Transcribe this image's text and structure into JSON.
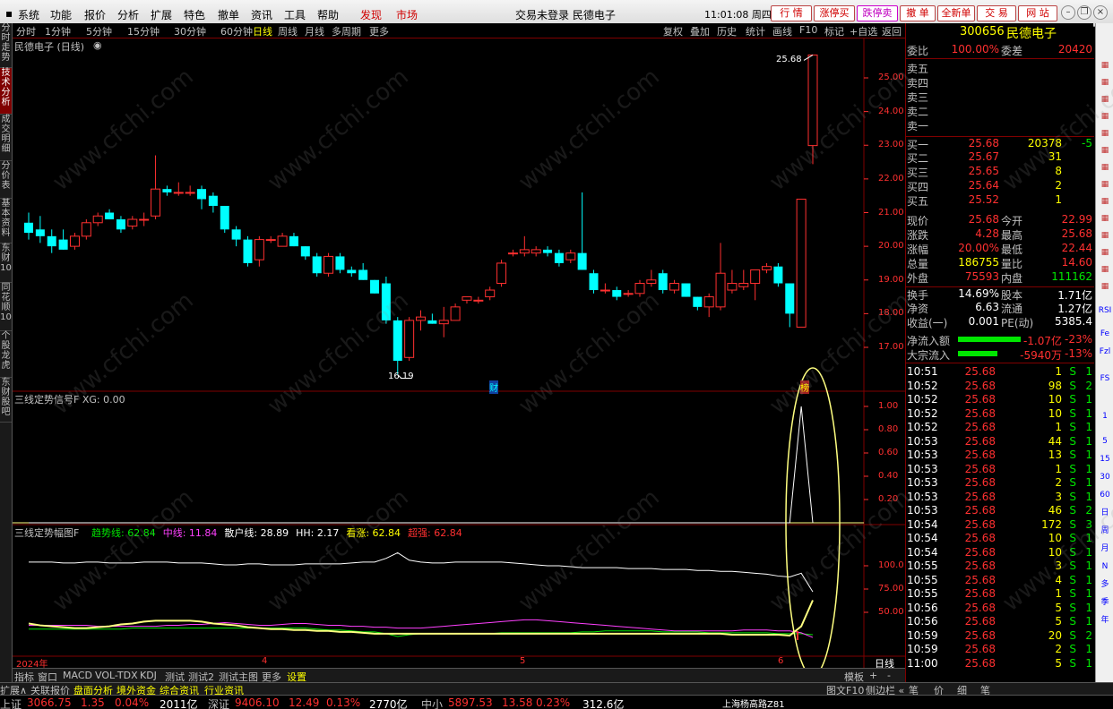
{
  "menu": {
    "items": [
      "系统",
      "功能",
      "报价",
      "分析",
      "扩展",
      "特色",
      "撤单",
      "资讯",
      "工具",
      "帮助"
    ],
    "discover": "发现",
    "market": "市场",
    "center_title": "交易未登录  民德电子",
    "clock": "11:01:08 周四",
    "buttons": [
      "行  情",
      "涨停买",
      "跌停卖",
      "撤  单",
      "全新单",
      "交  易",
      "网  站"
    ]
  },
  "toolbar": {
    "periods": [
      "分时",
      "1分钟",
      "5分钟",
      "15分钟",
      "30分钟",
      "60分钟",
      "日线",
      "周线",
      "月线",
      "多周期",
      "更多"
    ],
    "active_period": "日线",
    "right_tools": [
      "复权",
      "叠加",
      "历史",
      "统计",
      "画线",
      "F10",
      "标记",
      "+自选",
      "返回"
    ]
  },
  "left_tabs": [
    "分时走势",
    "技术分析",
    "成交明细",
    "分价表",
    "基本资料",
    "东财10",
    "同花顺10",
    "个股龙虎",
    "东财股吧"
  ],
  "main_chart": {
    "title": "民德电子 (日线)",
    "high_label": "25.68",
    "low_label": "16.19",
    "y_ticks": [
      "25.00",
      "24.00",
      "23.00",
      "22.00",
      "21.00",
      "20.00",
      "19.00",
      "18.00",
      "17.00"
    ],
    "marker_cai": "财",
    "marker_bang": "榜"
  },
  "signal_pane": {
    "title": "三线定势信号F  XG: 0.00",
    "y_ticks": [
      "1.00",
      "0.80",
      "0.60",
      "0.40",
      "0.20"
    ]
  },
  "trend_pane": {
    "title_prefix": "三线定势幅图F",
    "legend": [
      {
        "label": "趋势线: 62.84",
        "color": "#00e600"
      },
      {
        "label": "中线: 11.84",
        "color": "#ff40ff"
      },
      {
        "label": "散户线: 28.89",
        "color": "#ffffff"
      },
      {
        "label": "HH: 2.17",
        "color": "#ffffff"
      },
      {
        "label": "看涨: 62.84",
        "color": "#ffff00"
      },
      {
        "label": "超强: 62.84",
        "color": "#ff3030"
      }
    ],
    "y_ticks": [
      "100.0",
      "75.00",
      "50.00"
    ]
  },
  "x_axis": {
    "labels": [
      "2024年",
      "4",
      "5",
      "6"
    ],
    "period": "日线"
  },
  "quote": {
    "code": "300656",
    "name": "民德电子",
    "weibi_label": "委比",
    "weibi": "100.00%",
    "weicha_label": "委差",
    "weicha": "20420",
    "sells": [
      {
        "label": "卖五",
        "price": "",
        "vol": ""
      },
      {
        "label": "卖四",
        "price": "",
        "vol": ""
      },
      {
        "label": "卖三",
        "price": "",
        "vol": ""
      },
      {
        "label": "卖二",
        "price": "",
        "vol": ""
      },
      {
        "label": "卖一",
        "price": "",
        "vol": ""
      }
    ],
    "buys": [
      {
        "label": "买一",
        "price": "25.68",
        "vol": "20378",
        "chg": "-5"
      },
      {
        "label": "买二",
        "price": "25.67",
        "vol": "31",
        "chg": ""
      },
      {
        "label": "买三",
        "price": "25.65",
        "vol": "8",
        "chg": ""
      },
      {
        "label": "买四",
        "price": "25.64",
        "vol": "2",
        "chg": ""
      },
      {
        "label": "买五",
        "price": "25.52",
        "vol": "1",
        "chg": ""
      }
    ],
    "stats": [
      {
        "l1": "现价",
        "v1": "25.68",
        "c1": "red",
        "l2": "今开",
        "v2": "22.99",
        "c2": "red"
      },
      {
        "l1": "涨跌",
        "v1": "4.28",
        "c1": "red",
        "l2": "最高",
        "v2": "25.68",
        "c2": "red"
      },
      {
        "l1": "涨幅",
        "v1": "20.00%",
        "c1": "red",
        "l2": "最低",
        "v2": "22.44",
        "c2": "red"
      },
      {
        "l1": "总量",
        "v1": "186755",
        "c1": "yel",
        "l2": "量比",
        "v2": "14.60",
        "c2": "red"
      },
      {
        "l1": "外盘",
        "v1": "75593",
        "c1": "red",
        "l2": "内盘",
        "v2": "111162",
        "c2": "grn"
      },
      {
        "l1": "换手",
        "v1": "14.69%",
        "c1": "wht",
        "l2": "股本",
        "v2": "1.71亿",
        "c2": "wht"
      },
      {
        "l1": "净资",
        "v1": "6.63",
        "c1": "wht",
        "l2": "流通",
        "v2": "1.27亿",
        "c2": "wht"
      },
      {
        "l1": "收益(一)",
        "v1": "0.001",
        "c1": "wht",
        "l2": "PE(动)",
        "v2": "5385.4",
        "c2": "wht"
      }
    ],
    "netflow_label": "净流入额",
    "netflow": "-1.07亿",
    "netflow_pct": "-23%",
    "bigflow_label": "大宗流入",
    "bigflow": "-5940万",
    "bigflow_pct": "-13%"
  },
  "ticks": [
    {
      "t": "10:51",
      "p": "25.68",
      "v": "1",
      "d": "S",
      "n": "1"
    },
    {
      "t": "10:52",
      "p": "25.68",
      "v": "98",
      "d": "S",
      "n": "2"
    },
    {
      "t": "10:52",
      "p": "25.68",
      "v": "10",
      "d": "S",
      "n": "1"
    },
    {
      "t": "10:52",
      "p": "25.68",
      "v": "10",
      "d": "S",
      "n": "1"
    },
    {
      "t": "10:52",
      "p": "25.68",
      "v": "1",
      "d": "S",
      "n": "1"
    },
    {
      "t": "10:53",
      "p": "25.68",
      "v": "44",
      "d": "S",
      "n": "1"
    },
    {
      "t": "10:53",
      "p": "25.68",
      "v": "13",
      "d": "S",
      "n": "1"
    },
    {
      "t": "10:53",
      "p": "25.68",
      "v": "1",
      "d": "S",
      "n": "1"
    },
    {
      "t": "10:53",
      "p": "25.68",
      "v": "2",
      "d": "S",
      "n": "1"
    },
    {
      "t": "10:53",
      "p": "25.68",
      "v": "3",
      "d": "S",
      "n": "1"
    },
    {
      "t": "10:53",
      "p": "25.68",
      "v": "46",
      "d": "S",
      "n": "2"
    },
    {
      "t": "10:54",
      "p": "25.68",
      "v": "172",
      "d": "S",
      "n": "3"
    },
    {
      "t": "10:54",
      "p": "25.68",
      "v": "10",
      "d": "S",
      "n": "1"
    },
    {
      "t": "10:54",
      "p": "25.68",
      "v": "10",
      "d": "S",
      "n": "1"
    },
    {
      "t": "10:55",
      "p": "25.68",
      "v": "3",
      "d": "S",
      "n": "1"
    },
    {
      "t": "10:55",
      "p": "25.68",
      "v": "4",
      "d": "S",
      "n": "1"
    },
    {
      "t": "10:55",
      "p": "25.68",
      "v": "1",
      "d": "S",
      "n": "1"
    },
    {
      "t": "10:56",
      "p": "25.68",
      "v": "5",
      "d": "S",
      "n": "1"
    },
    {
      "t": "10:56",
      "p": "25.68",
      "v": "5",
      "d": "S",
      "n": "1"
    },
    {
      "t": "10:59",
      "p": "25.68",
      "v": "20",
      "d": "S",
      "n": "2"
    },
    {
      "t": "10:59",
      "p": "25.68",
      "v": "2",
      "d": "S",
      "n": "1"
    },
    {
      "t": "11:00",
      "p": "25.68",
      "v": "5",
      "d": "S",
      "n": "1"
    }
  ],
  "icon_col": [
    "RSI",
    "Fe",
    "Fzl",
    "FS",
    "1",
    "5",
    "15",
    "30",
    "60",
    "日",
    "周",
    "月",
    "N",
    "多",
    "季",
    "年"
  ],
  "bottom_tabs": [
    "指标",
    "窗口",
    "MACD",
    "VOL-TDX",
    "KDJ",
    "测试",
    "测试2",
    "测试主图",
    "更多",
    "设置"
  ],
  "bottom_right": [
    "模板",
    "+",
    "-"
  ],
  "bottom_tabs2": [
    "扩展∧",
    "关联报价",
    "盘面分析",
    "境外资金",
    "综合资讯",
    "行业资讯"
  ],
  "bottom_tabs2_right": [
    "图文F10",
    "侧边栏 «"
  ],
  "bottom_tabs2_far": [
    "笔",
    "价",
    "细",
    "笔"
  ],
  "status": [
    {
      "txt": "上证",
      "c": "gray"
    },
    {
      "txt": "3066.75",
      "c": "red"
    },
    {
      "txt": "1.35",
      "c": "red"
    },
    {
      "txt": "0.04%",
      "c": "red"
    },
    {
      "txt": "2011亿",
      "c": "wht"
    },
    {
      "txt": "深证",
      "c": "gray"
    },
    {
      "txt": "9406.10",
      "c": "red"
    },
    {
      "txt": "12.49",
      "c": "red"
    },
    {
      "txt": "0.13%",
      "c": "red"
    },
    {
      "txt": "2770亿",
      "c": "wht"
    },
    {
      "txt": "中小",
      "c": "gray"
    },
    {
      "txt": "5897.53",
      "c": "red"
    },
    {
      "txt": "13.58",
      "c": "red"
    },
    {
      "txt": "0.23%",
      "c": "red"
    },
    {
      "txt": "312.6亿",
      "c": "wht"
    },
    {
      "txt": "上海杨高路Z81",
      "c": "wht"
    }
  ],
  "watermark": "www.cfchi.com",
  "colors": {
    "up": "#ff3030",
    "down": "#00ffff",
    "accent": "#800000",
    "highlight": "#ffff80"
  },
  "chart_data": {
    "type": "candlestick",
    "ylim": [
      16.19,
      25.68
    ],
    "candles": [
      {
        "o": 20.7,
        "h": 21.0,
        "l": 20.2,
        "c": 20.4
      },
      {
        "o": 20.5,
        "h": 20.9,
        "l": 20.1,
        "c": 20.3
      },
      {
        "o": 20.3,
        "h": 20.5,
        "l": 19.8,
        "c": 20.0
      },
      {
        "o": 20.2,
        "h": 20.5,
        "l": 19.9,
        "c": 19.9
      },
      {
        "o": 20.0,
        "h": 20.4,
        "l": 19.9,
        "c": 20.3
      },
      {
        "o": 20.3,
        "h": 20.8,
        "l": 20.2,
        "c": 20.7
      },
      {
        "o": 20.7,
        "h": 21.0,
        "l": 20.6,
        "c": 20.9
      },
      {
        "o": 21.0,
        "h": 21.1,
        "l": 20.8,
        "c": 20.8
      },
      {
        "o": 20.8,
        "h": 20.9,
        "l": 20.4,
        "c": 20.5
      },
      {
        "o": 20.6,
        "h": 20.9,
        "l": 20.5,
        "c": 20.8
      },
      {
        "o": 20.8,
        "h": 21.0,
        "l": 20.6,
        "c": 20.8
      },
      {
        "o": 20.9,
        "h": 22.7,
        "l": 20.8,
        "c": 21.7
      },
      {
        "o": 21.7,
        "h": 21.8,
        "l": 21.5,
        "c": 21.6
      },
      {
        "o": 21.6,
        "h": 21.9,
        "l": 21.5,
        "c": 21.6
      },
      {
        "o": 21.6,
        "h": 21.8,
        "l": 21.5,
        "c": 21.6
      },
      {
        "o": 21.7,
        "h": 21.8,
        "l": 21.1,
        "c": 21.4
      },
      {
        "o": 21.5,
        "h": 21.6,
        "l": 21.0,
        "c": 21.2
      },
      {
        "o": 21.2,
        "h": 21.2,
        "l": 20.4,
        "c": 20.5
      },
      {
        "o": 20.5,
        "h": 20.6,
        "l": 20.0,
        "c": 20.2
      },
      {
        "o": 20.2,
        "h": 20.3,
        "l": 19.4,
        "c": 19.5
      },
      {
        "o": 19.6,
        "h": 20.3,
        "l": 19.4,
        "c": 20.2
      },
      {
        "o": 20.2,
        "h": 20.3,
        "l": 20.1,
        "c": 20.2
      },
      {
        "o": 20.0,
        "h": 20.4,
        "l": 20.0,
        "c": 20.3
      },
      {
        "o": 20.3,
        "h": 20.4,
        "l": 20.0,
        "c": 20.0
      },
      {
        "o": 20.0,
        "h": 20.0,
        "l": 19.6,
        "c": 19.7
      },
      {
        "o": 19.7,
        "h": 19.8,
        "l": 19.1,
        "c": 19.2
      },
      {
        "o": 19.2,
        "h": 19.8,
        "l": 19.1,
        "c": 19.7
      },
      {
        "o": 19.7,
        "h": 19.8,
        "l": 19.2,
        "c": 19.3
      },
      {
        "o": 19.3,
        "h": 19.4,
        "l": 19.1,
        "c": 19.2
      },
      {
        "o": 19.3,
        "h": 19.5,
        "l": 19.0,
        "c": 19.0
      },
      {
        "o": 19.0,
        "h": 19.0,
        "l": 18.6,
        "c": 18.6
      },
      {
        "o": 18.9,
        "h": 19.1,
        "l": 17.7,
        "c": 17.8
      },
      {
        "o": 17.8,
        "h": 17.9,
        "l": 16.2,
        "c": 16.6
      },
      {
        "o": 16.7,
        "h": 17.9,
        "l": 16.6,
        "c": 17.8
      },
      {
        "o": 17.8,
        "h": 18.1,
        "l": 17.5,
        "c": 17.9
      },
      {
        "o": 17.8,
        "h": 18.0,
        "l": 17.7,
        "c": 17.7
      },
      {
        "o": 17.7,
        "h": 18.2,
        "l": 17.3,
        "c": 17.8
      },
      {
        "o": 17.8,
        "h": 18.3,
        "l": 17.8,
        "c": 18.2
      },
      {
        "o": 18.4,
        "h": 18.5,
        "l": 18.3,
        "c": 18.5
      },
      {
        "o": 18.4,
        "h": 18.5,
        "l": 18.3,
        "c": 18.4
      },
      {
        "o": 18.5,
        "h": 18.8,
        "l": 18.4,
        "c": 18.7
      },
      {
        "o": 18.9,
        "h": 19.6,
        "l": 18.8,
        "c": 19.5
      },
      {
        "o": 19.8,
        "h": 19.9,
        "l": 19.7,
        "c": 19.8
      },
      {
        "o": 19.8,
        "h": 20.3,
        "l": 19.7,
        "c": 19.9
      },
      {
        "o": 19.8,
        "h": 20.0,
        "l": 19.7,
        "c": 19.9
      },
      {
        "o": 19.9,
        "h": 20.0,
        "l": 19.7,
        "c": 19.8
      },
      {
        "o": 19.8,
        "h": 19.9,
        "l": 19.4,
        "c": 19.5
      },
      {
        "o": 19.6,
        "h": 19.9,
        "l": 19.5,
        "c": 19.8
      },
      {
        "o": 19.8,
        "h": 21.6,
        "l": 19.3,
        "c": 19.3
      },
      {
        "o": 19.2,
        "h": 19.3,
        "l": 18.6,
        "c": 18.7
      },
      {
        "o": 18.7,
        "h": 18.9,
        "l": 18.6,
        "c": 18.7
      },
      {
        "o": 18.7,
        "h": 18.8,
        "l": 18.4,
        "c": 18.5
      },
      {
        "o": 18.6,
        "h": 18.7,
        "l": 18.5,
        "c": 18.6
      },
      {
        "o": 18.6,
        "h": 19.0,
        "l": 18.5,
        "c": 18.9
      },
      {
        "o": 18.9,
        "h": 19.3,
        "l": 18.8,
        "c": 19.0
      },
      {
        "o": 19.2,
        "h": 19.3,
        "l": 18.6,
        "c": 18.7
      },
      {
        "o": 18.7,
        "h": 19.0,
        "l": 18.6,
        "c": 18.9
      },
      {
        "o": 18.9,
        "h": 18.9,
        "l": 18.5,
        "c": 18.5
      },
      {
        "o": 18.5,
        "h": 18.5,
        "l": 18.1,
        "c": 18.2
      },
      {
        "o": 18.2,
        "h": 18.6,
        "l": 17.9,
        "c": 18.5
      },
      {
        "o": 18.2,
        "h": 20.1,
        "l": 18.1,
        "c": 19.2
      },
      {
        "o": 18.7,
        "h": 19.3,
        "l": 18.6,
        "c": 18.9
      },
      {
        "o": 18.8,
        "h": 19.3,
        "l": 18.7,
        "c": 18.9
      },
      {
        "o": 18.9,
        "h": 19.3,
        "l": 18.4,
        "c": 19.3
      },
      {
        "o": 19.3,
        "h": 19.5,
        "l": 19.2,
        "c": 19.4
      },
      {
        "o": 19.4,
        "h": 19.5,
        "l": 18.8,
        "c": 18.9
      },
      {
        "o": 18.9,
        "h": 18.9,
        "l": 17.6,
        "c": 18.0
      },
      {
        "o": 17.6,
        "h": 21.4,
        "l": 17.6,
        "c": 21.4
      },
      {
        "o": 22.99,
        "h": 25.68,
        "l": 22.44,
        "c": 25.68
      }
    ],
    "signal_series": [
      0,
      0,
      0,
      0,
      0,
      0,
      0,
      0,
      0,
      0,
      0,
      0,
      0,
      0,
      0,
      0,
      0,
      0,
      0,
      0,
      0,
      0,
      0,
      0,
      0,
      0,
      0,
      0,
      0,
      0,
      0,
      0,
      0,
      0,
      0,
      0,
      0,
      0,
      0,
      0,
      0,
      0,
      0,
      0,
      0,
      0,
      0,
      0,
      0,
      0,
      0,
      0,
      0,
      0,
      0,
      0,
      0,
      0,
      0,
      0,
      0,
      0,
      0,
      0,
      0,
      0,
      0,
      1.0,
      0.0
    ],
    "trend_white": [
      104,
      104,
      104,
      103,
      103,
      104,
      104,
      103,
      103,
      103,
      104,
      104,
      104,
      103,
      103,
      103,
      102,
      101,
      101,
      102,
      102,
      101,
      101,
      101,
      102,
      102,
      102,
      102,
      103,
      104,
      104,
      108,
      114,
      106,
      104,
      103,
      103,
      104,
      104,
      104,
      104,
      104,
      103,
      102,
      101,
      100,
      100,
      99,
      98,
      98,
      98,
      98,
      97,
      97,
      97,
      96,
      96,
      96,
      95,
      95,
      94,
      94,
      93,
      92,
      91,
      89,
      88,
      92,
      72
    ],
    "trend_yellow": [
      38,
      36,
      35,
      34,
      33,
      33,
      34,
      35,
      37,
      38,
      40,
      41,
      41,
      41,
      41,
      40,
      38,
      37,
      36,
      34,
      33,
      32,
      32,
      31,
      31,
      30,
      30,
      29,
      29,
      28,
      27,
      27,
      27,
      27,
      27,
      27,
      27,
      27,
      27,
      27,
      27,
      27,
      27,
      27,
      27,
      27,
      27,
      27,
      27,
      27,
      27,
      27,
      27,
      27,
      27,
      27,
      27,
      27,
      27,
      27,
      27,
      26,
      26,
      26,
      26,
      26,
      25,
      35,
      63
    ],
    "trend_magenta": [
      36,
      36,
      36,
      36,
      36,
      36,
      35,
      35,
      35,
      35,
      35,
      35,
      36,
      36,
      37,
      37,
      38,
      39,
      38,
      37,
      36,
      36,
      37,
      38,
      38,
      37,
      36,
      36,
      35,
      35,
      34,
      34,
      33,
      33,
      33,
      34,
      35,
      36,
      37,
      38,
      39,
      40,
      41,
      42,
      42,
      41,
      40,
      39,
      38,
      37,
      36,
      35,
      34,
      33,
      32,
      31,
      30,
      30,
      30,
      30,
      30,
      30,
      31,
      31,
      31,
      30,
      30,
      28,
      23
    ],
    "trend_green": [
      32,
      32,
      32,
      32,
      32,
      32,
      32,
      32,
      32,
      33,
      33,
      33,
      33,
      33,
      33,
      33,
      33,
      33,
      33,
      33,
      33,
      33,
      33,
      33,
      33,
      32,
      31,
      31,
      30,
      29,
      29,
      27,
      24,
      26,
      27,
      27,
      27,
      27,
      27,
      27,
      27,
      28,
      28,
      28,
      28,
      28,
      28,
      28,
      29,
      29,
      30,
      30,
      30,
      30,
      30,
      29,
      29,
      29,
      29,
      28,
      28,
      28,
      28,
      28,
      28,
      27,
      27,
      27,
      26
    ]
  }
}
